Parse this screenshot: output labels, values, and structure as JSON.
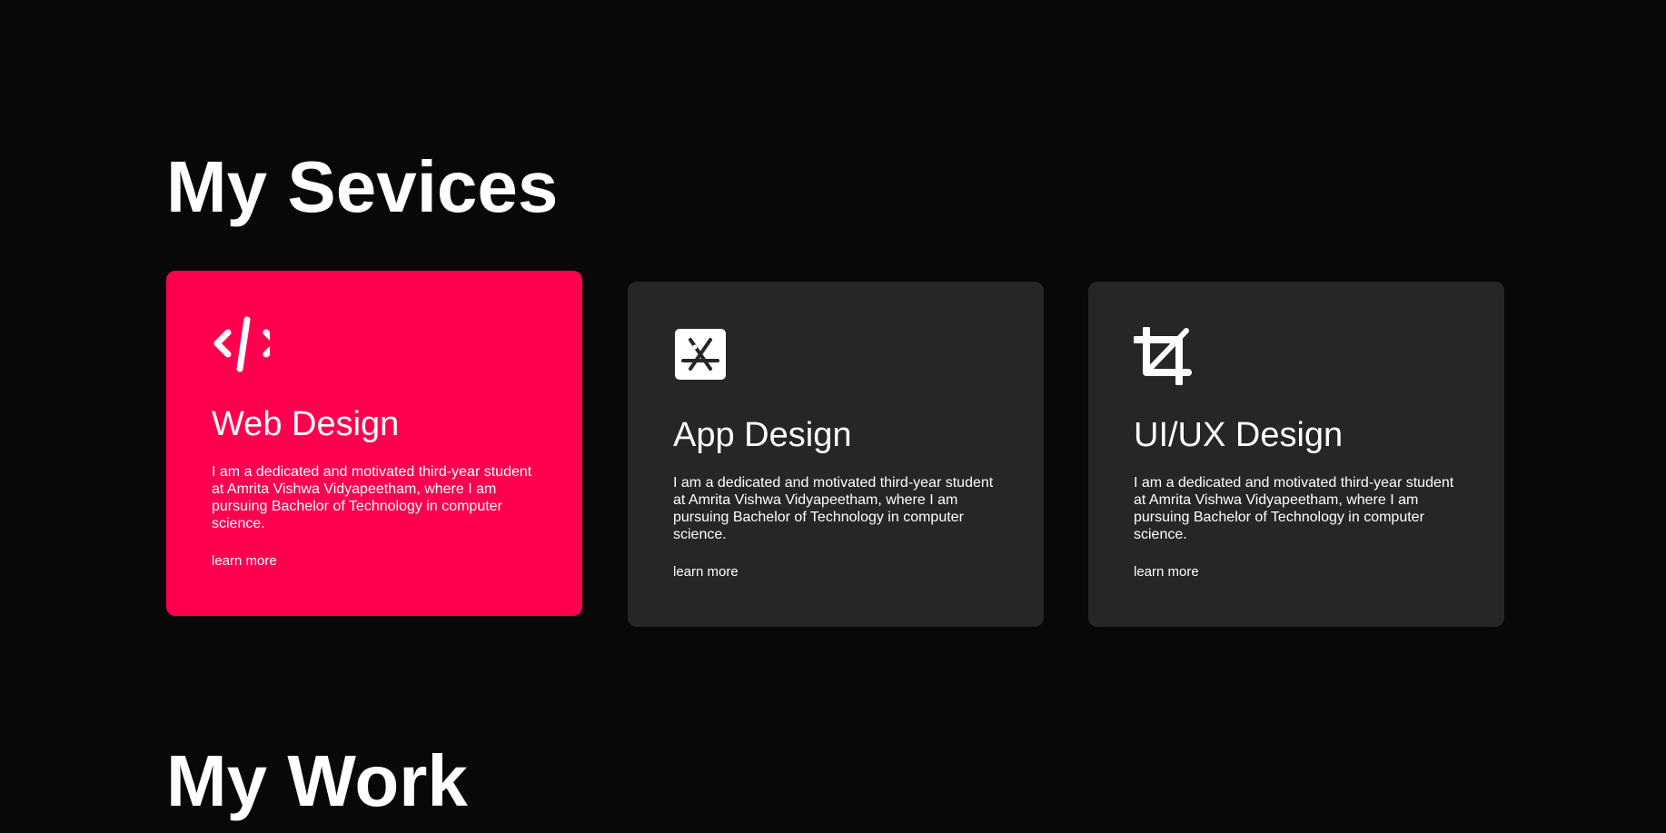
{
  "colors": {
    "background": "#080808",
    "card": "#262626",
    "accent": "#ff004f",
    "text": "#ffffff"
  },
  "services": {
    "title": "My Sevices",
    "cards": [
      {
        "icon": "code-icon",
        "title": "Web Design",
        "description": "I am a dedicated and motivated third-year student at Amrita Vishwa Vidyapeetham, where I am pursuing Bachelor of Technology in computer science.",
        "link": "learn more",
        "active": true
      },
      {
        "icon": "app-store-icon",
        "title": "App Design",
        "description": "I am a dedicated and motivated third-year student at Amrita Vishwa Vidyapeetham, where I am pursuing Bachelor of Technology in computer science.",
        "link": "learn more",
        "active": false
      },
      {
        "icon": "crop-icon",
        "title": "UI/UX Design",
        "description": "I am a dedicated and motivated third-year student at Amrita Vishwa Vidyapeetham, where I am pursuing Bachelor of Technology in computer science.",
        "link": "learn more",
        "active": false
      }
    ]
  },
  "work": {
    "title": "My Work"
  }
}
